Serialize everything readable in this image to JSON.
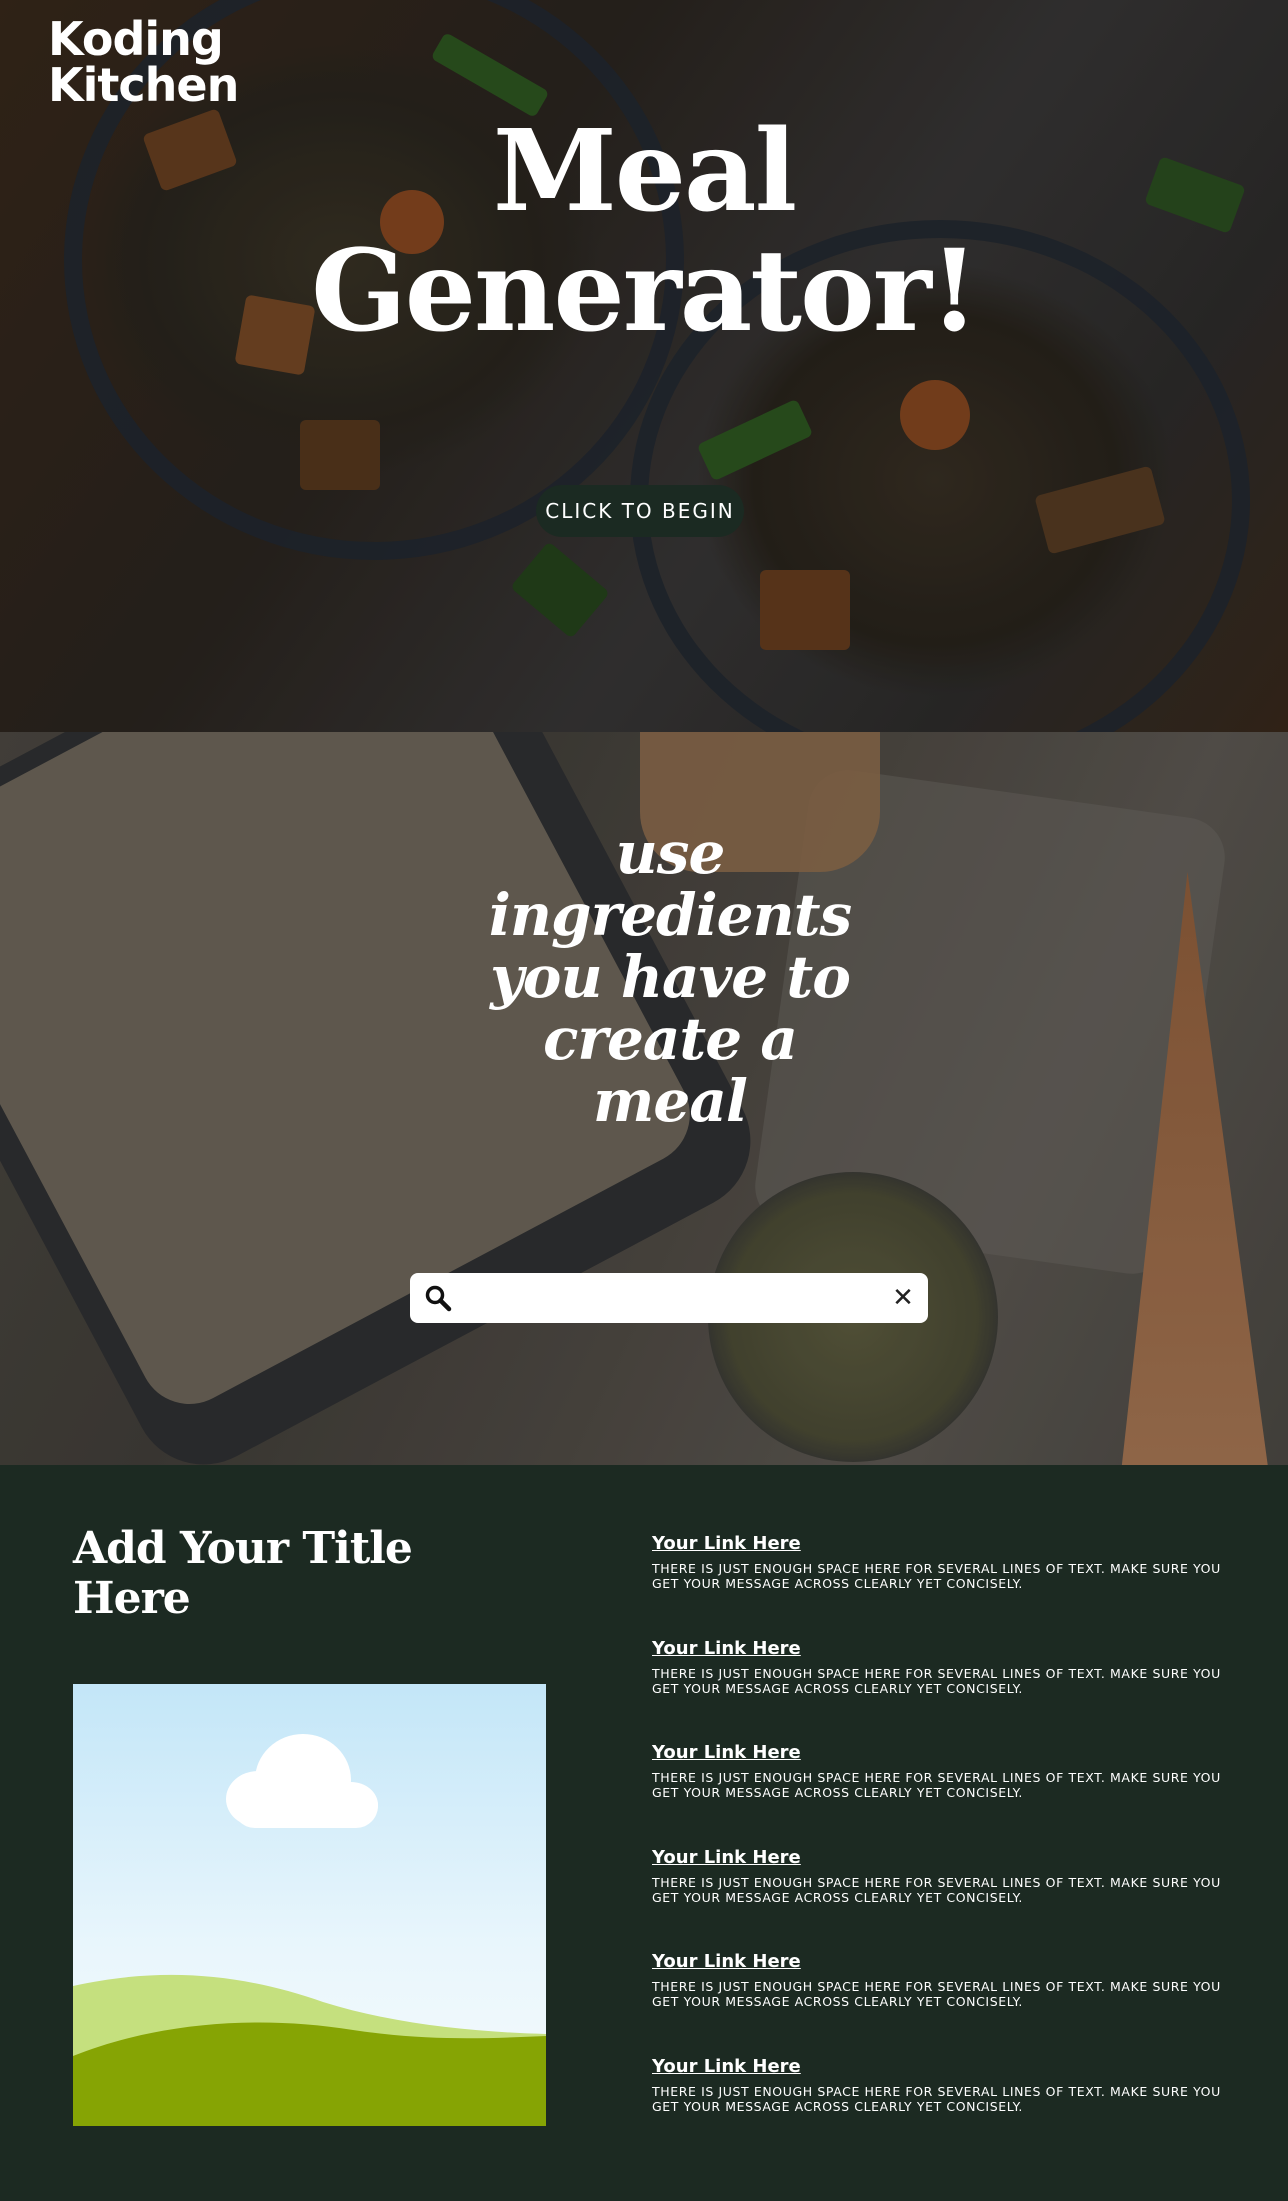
{
  "brand": {
    "line1": "Koding",
    "line2": "Kitchen"
  },
  "hero": {
    "title_line1": "Meal",
    "title_line2": "Generator!",
    "cta_label": "CLICK TO BEGIN"
  },
  "ingredients": {
    "tagline": "use ingredients you have to create a meal",
    "search": {
      "placeholder": "",
      "value": "",
      "icon": "search-icon",
      "clear_icon": "close-icon",
      "clear_glyph": "✕"
    }
  },
  "footer": {
    "title": "Add Your Title Here",
    "image_icon": "image-placeholder-icon",
    "links": [
      {
        "label": "Your Link Here",
        "text": "There is just enough space here for several lines of text. Make sure you get your message across clearly yet concisely."
      },
      {
        "label": "Your Link Here",
        "text": "There is just enough space here for several lines of text. Make sure you get your message across clearly yet concisely."
      },
      {
        "label": "Your Link Here",
        "text": "There is just enough space here for several lines of text. Make sure you get your message across clearly yet concisely."
      },
      {
        "label": "Your Link Here",
        "text": "There is just enough space here for several lines of text. Make sure you get your message across clearly yet concisely."
      },
      {
        "label": "Your Link Here",
        "text": "There is just enough space here for several lines of text. Make sure you get your message across clearly yet concisely."
      },
      {
        "label": "Your Link Here",
        "text": "There is just enough space here for several lines of text. Make sure you get your message across clearly yet concisely."
      }
    ]
  },
  "colors": {
    "footer_bg": "#1c2a22",
    "cta_bg": "#1b2a22",
    "text": "#ffffff"
  }
}
